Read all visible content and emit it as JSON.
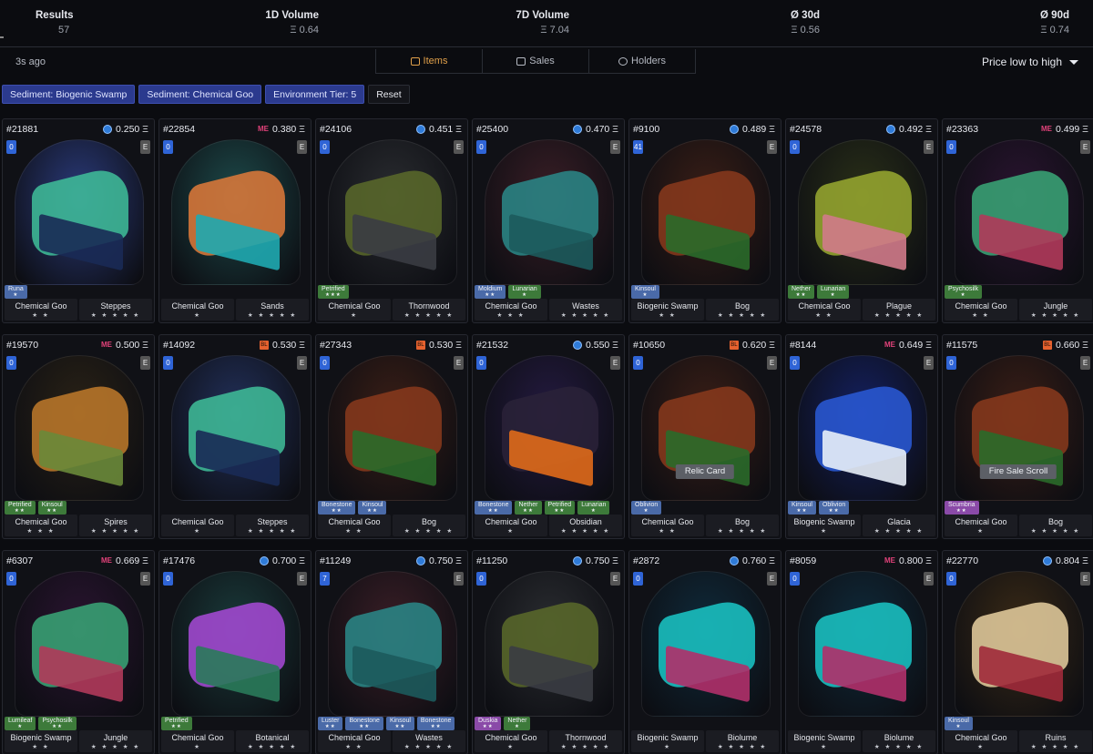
{
  "stats": [
    {
      "label": "Results",
      "value": "57"
    },
    {
      "label": "1D Volume",
      "value": "Ξ 0.64"
    },
    {
      "label": "7D Volume",
      "value": "Ξ 7.04"
    },
    {
      "label": "Ø 30d",
      "value": "Ξ 0.56"
    },
    {
      "label": "Ø 90d",
      "value": "Ξ 0.74"
    }
  ],
  "updated": "3s ago",
  "tabs": [
    {
      "label": "Items",
      "icon": "items-icon",
      "active": true
    },
    {
      "label": "Sales",
      "icon": "sales-icon",
      "active": false
    },
    {
      "label": "Holders",
      "icon": "holders-icon",
      "active": false
    }
  ],
  "sort": {
    "label": "Price low to high",
    "icon": "chevron-down-icon"
  },
  "filters": [
    "Sediment: Biogenic Swamp",
    "Sediment: Chemical Goo",
    "Environment Tier: 5"
  ],
  "reset_label": "Reset",
  "market_colors": {
    "opensea": "#2f7bd8",
    "magiceden": "#e2427a",
    "blur": "#e5612e"
  },
  "cards": [
    {
      "id": "#21881",
      "market": "opensea",
      "price": "0.250 Ξ",
      "level": "0",
      "tier": "E",
      "palette": [
        "#2a3a7a",
        "#3fbf9a",
        "#1a2a55"
      ],
      "overlay": "",
      "attrs": [
        {
          "name": "Runa",
          "stars": "★",
          "color": "#4a6aa8"
        }
      ],
      "sediment": "Chemical Goo",
      "sediment_stars": "★ ★",
      "biome": "Steppes",
      "biome_stars": "★ ★ ★ ★ ★"
    },
    {
      "id": "#22854",
      "market": "magiceden",
      "price": "0.380 Ξ",
      "level": "0",
      "tier": "E",
      "palette": [
        "#1d4a4a",
        "#e07a3a",
        "#1fa8b0"
      ],
      "overlay": "",
      "attrs": [],
      "sediment": "Chemical Goo",
      "sediment_stars": "★",
      "biome": "Sands",
      "biome_stars": "★ ★ ★ ★ ★"
    },
    {
      "id": "#24106",
      "market": "opensea",
      "price": "0.451 Ξ",
      "level": "0",
      "tier": "E",
      "palette": [
        "#2a2c30",
        "#5a6a2a",
        "#3a3c42"
      ],
      "overlay": "",
      "attrs": [
        {
          "name": "Petrified",
          "stars": "★★★",
          "color": "#3d7a3a"
        }
      ],
      "sediment": "Chemical Goo",
      "sediment_stars": "★",
      "biome": "Thornwood",
      "biome_stars": "★ ★ ★ ★ ★"
    },
    {
      "id": "#25400",
      "market": "opensea",
      "price": "0.470 Ξ",
      "level": "0",
      "tier": "E",
      "palette": [
        "#3a1e26",
        "#2a8a8a",
        "#1c5a5c"
      ],
      "overlay": "",
      "attrs": [
        {
          "name": "Moldium",
          "stars": "★★",
          "color": "#4a6aa8"
        },
        {
          "name": "Lunarian",
          "stars": "★",
          "color": "#3d7a3a"
        }
      ],
      "sediment": "Chemical Goo",
      "sediment_stars": "★ ★ ★",
      "biome": "Wastes",
      "biome_stars": "★ ★ ★ ★ ★"
    },
    {
      "id": "#9100",
      "market": "opensea",
      "price": "0.489 Ξ",
      "level": "41",
      "tier": "E",
      "palette": [
        "#3a1e16",
        "#8a3a1c",
        "#2a6a2a"
      ],
      "overlay": "",
      "attrs": [
        {
          "name": "Kinsoul",
          "stars": "★",
          "color": "#4a6aa8"
        }
      ],
      "sediment": "Biogenic Swamp",
      "sediment_stars": "★ ★",
      "biome": "Bog",
      "biome_stars": "★ ★ ★ ★ ★"
    },
    {
      "id": "#24578",
      "market": "opensea",
      "price": "0.492 Ξ",
      "level": "0",
      "tier": "E",
      "palette": [
        "#2a3018",
        "#9aaa30",
        "#d07a8a"
      ],
      "overlay": "",
      "attrs": [
        {
          "name": "Nether",
          "stars": "★★",
          "color": "#3d7a3a"
        },
        {
          "name": "Lunarian",
          "stars": "★",
          "color": "#3d7a3a"
        }
      ],
      "sediment": "Chemical Goo",
      "sediment_stars": "★ ★",
      "biome": "Plague",
      "biome_stars": "★ ★ ★ ★ ★"
    },
    {
      "id": "#23363",
      "market": "magiceden",
      "price": "0.499 Ξ",
      "level": "0",
      "tier": "E",
      "palette": [
        "#2a1430",
        "#3aa878",
        "#b03a5a"
      ],
      "overlay": "",
      "attrs": [
        {
          "name": "Psychosilk",
          "stars": "★",
          "color": "#3d7a3a"
        }
      ],
      "sediment": "Chemical Goo",
      "sediment_stars": "★ ★",
      "biome": "Jungle",
      "biome_stars": "★ ★ ★ ★ ★"
    },
    {
      "id": "#19570",
      "market": "magiceden",
      "price": "0.500 Ξ",
      "level": "0",
      "tier": "E",
      "palette": [
        "#2a2216",
        "#c07a2a",
        "#6a8a3a"
      ],
      "overlay": "",
      "attrs": [
        {
          "name": "Petrified",
          "stars": "★★",
          "color": "#3d7a3a"
        },
        {
          "name": "Kinsoul",
          "stars": "★★",
          "color": "#3d7a3a"
        }
      ],
      "sediment": "Chemical Goo",
      "sediment_stars": "★ ★ ★",
      "biome": "Spires",
      "biome_stars": "★ ★ ★ ★ ★"
    },
    {
      "id": "#14092",
      "market": "blur",
      "price": "0.530 Ξ",
      "level": "0",
      "tier": "E",
      "palette": [
        "#22305a",
        "#3fbf9a",
        "#1a2a55"
      ],
      "overlay": "",
      "attrs": [],
      "sediment": "Chemical Goo",
      "sediment_stars": "★",
      "biome": "Steppes",
      "biome_stars": "★ ★ ★ ★ ★"
    },
    {
      "id": "#27343",
      "market": "blur",
      "price": "0.530 Ξ",
      "level": "0",
      "tier": "E",
      "palette": [
        "#3a1e16",
        "#8a3a1c",
        "#2a6a2a"
      ],
      "overlay": "",
      "attrs": [
        {
          "name": "Bonestone",
          "stars": "★★",
          "color": "#4a6aa8"
        },
        {
          "name": "Kinsoul",
          "stars": "★★",
          "color": "#4a6aa8"
        }
      ],
      "sediment": "Chemical Goo",
      "sediment_stars": "★ ★",
      "biome": "Bog",
      "biome_stars": "★ ★ ★ ★ ★"
    },
    {
      "id": "#21532",
      "market": "opensea",
      "price": "0.550 Ξ",
      "level": "0",
      "tier": "E",
      "palette": [
        "#241a40",
        "#2a2238",
        "#e06a1a"
      ],
      "overlay": "",
      "attrs": [
        {
          "name": "Bonestone",
          "stars": "★★",
          "color": "#4a6aa8"
        },
        {
          "name": "Nether",
          "stars": "★★",
          "color": "#3d7a3a"
        },
        {
          "name": "Petrified",
          "stars": "★★",
          "color": "#3d7a3a"
        },
        {
          "name": "Lunarian",
          "stars": "★",
          "color": "#3d7a3a"
        }
      ],
      "sediment": "Chemical Goo",
      "sediment_stars": "★",
      "biome": "Obsidian",
      "biome_stars": "★ ★ ★ ★ ★"
    },
    {
      "id": "#10650",
      "market": "blur",
      "price": "0.620 Ξ",
      "level": "0",
      "tier": "E",
      "palette": [
        "#3a1e16",
        "#8a3a1c",
        "#2a6a2a"
      ],
      "overlay": "Relic Card",
      "attrs": [
        {
          "name": "Oblivion",
          "stars": "★",
          "color": "#4a6aa8"
        }
      ],
      "sediment": "Chemical Goo",
      "sediment_stars": "★ ★",
      "biome": "Bog",
      "biome_stars": "★ ★ ★ ★ ★"
    },
    {
      "id": "#8144",
      "market": "magiceden",
      "price": "0.649 Ξ",
      "level": "0",
      "tier": "E",
      "palette": [
        "#142060",
        "#2a5ad8",
        "#e8eef8"
      ],
      "overlay": "",
      "attrs": [
        {
          "name": "Kinsoul",
          "stars": "★★",
          "color": "#4a6aa8"
        },
        {
          "name": "Oblivion",
          "stars": "★★",
          "color": "#4a6aa8"
        }
      ],
      "sediment": "Biogenic Swamp",
      "sediment_stars": "★",
      "biome": "Glacia",
      "biome_stars": "★ ★ ★ ★ ★"
    },
    {
      "id": "#11575",
      "market": "blur",
      "price": "0.660 Ξ",
      "level": "0",
      "tier": "E",
      "palette": [
        "#3a1e16",
        "#8a3a1c",
        "#2a6a2a"
      ],
      "overlay": "Fire Sale Scroll",
      "attrs": [
        {
          "name": "Scumbria",
          "stars": "★★",
          "color": "#8a4aa8"
        }
      ],
      "sediment": "Chemical Goo",
      "sediment_stars": "★",
      "biome": "Bog",
      "biome_stars": "★ ★ ★ ★ ★"
    },
    {
      "id": "#6307",
      "market": "magiceden",
      "price": "0.669 Ξ",
      "level": "0",
      "tier": "E",
      "palette": [
        "#2a1430",
        "#3aa878",
        "#b03a5a"
      ],
      "overlay": "",
      "attrs": [
        {
          "name": "Lumileaf",
          "stars": "★",
          "color": "#3d7a3a"
        },
        {
          "name": "Psychosilk",
          "stars": "★★",
          "color": "#3d7a3a"
        }
      ],
      "sediment": "Biogenic Swamp",
      "sediment_stars": "★ ★",
      "biome": "Jungle",
      "biome_stars": "★ ★ ★ ★ ★"
    },
    {
      "id": "#17476",
      "market": "opensea",
      "price": "0.700 Ξ",
      "level": "0",
      "tier": "E",
      "palette": [
        "#1a3a3a",
        "#a84ad8",
        "#2a7a5a"
      ],
      "overlay": "",
      "attrs": [
        {
          "name": "Petrified",
          "stars": "★★",
          "color": "#3d7a3a"
        }
      ],
      "sediment": "Chemical Goo",
      "sediment_stars": "★",
      "biome": "Botanical",
      "biome_stars": "★ ★ ★ ★ ★"
    },
    {
      "id": "#11249",
      "market": "opensea",
      "price": "0.750 Ξ",
      "level": "7",
      "tier": "E",
      "palette": [
        "#3a1e26",
        "#2a8a8a",
        "#1c5a5c"
      ],
      "overlay": "",
      "attrs": [
        {
          "name": "Luster",
          "stars": "★★",
          "color": "#4a6aa8"
        },
        {
          "name": "Bonestone",
          "stars": "★★",
          "color": "#4a6aa8"
        },
        {
          "name": "Kinsoul",
          "stars": "★★",
          "color": "#4a6aa8"
        },
        {
          "name": "Bonestone",
          "stars": "★★",
          "color": "#4a6aa8"
        }
      ],
      "sediment": "Chemical Goo",
      "sediment_stars": "★ ★",
      "biome": "Wastes",
      "biome_stars": "★ ★ ★ ★ ★"
    },
    {
      "id": "#11250",
      "market": "opensea",
      "price": "0.750 Ξ",
      "level": "0",
      "tier": "E",
      "palette": [
        "#2a2c30",
        "#5a6a2a",
        "#3a3c42"
      ],
      "overlay": "",
      "attrs": [
        {
          "name": "Duskia",
          "stars": "★★",
          "color": "#8a4aa8"
        },
        {
          "name": "Nether",
          "stars": "★",
          "color": "#3d7a3a"
        }
      ],
      "sediment": "Chemical Goo",
      "sediment_stars": "★",
      "biome": "Thornwood",
      "biome_stars": "★ ★ ★ ★ ★"
    },
    {
      "id": "#2872",
      "market": "opensea",
      "price": "0.760 Ξ",
      "level": "0",
      "tier": "E",
      "palette": [
        "#0f2a3a",
        "#1ac8c8",
        "#b0306a"
      ],
      "overlay": "",
      "attrs": [],
      "sediment": "Biogenic Swamp",
      "sediment_stars": "★",
      "biome": "Biolume",
      "biome_stars": "★ ★ ★ ★ ★"
    },
    {
      "id": "#8059",
      "market": "magiceden",
      "price": "0.800 Ξ",
      "level": "0",
      "tier": "E",
      "palette": [
        "#0f2a3a",
        "#1ac8c8",
        "#b0306a"
      ],
      "overlay": "",
      "attrs": [],
      "sediment": "Biogenic Swamp",
      "sediment_stars": "★",
      "biome": "Biolume",
      "biome_stars": "★ ★ ★ ★ ★"
    },
    {
      "id": "#22770",
      "market": "opensea",
      "price": "0.804 Ξ",
      "level": "0",
      "tier": "E",
      "palette": [
        "#3a2a16",
        "#e8d0a0",
        "#a02a3a"
      ],
      "overlay": "",
      "attrs": [
        {
          "name": "Kinsoul",
          "stars": "★",
          "color": "#4a6aa8"
        }
      ],
      "sediment": "Chemical Goo",
      "sediment_stars": "★",
      "biome": "Ruins",
      "biome_stars": "★ ★ ★ ★ ★"
    }
  ]
}
